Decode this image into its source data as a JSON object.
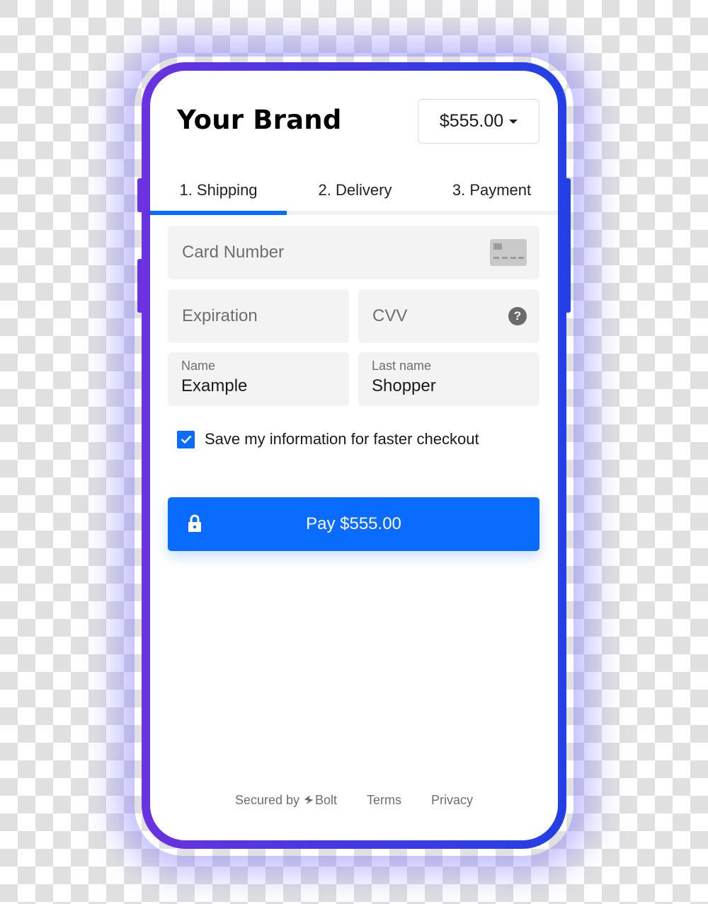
{
  "header": {
    "brand": "Your Brand",
    "amount_selector": "$555.00"
  },
  "tabs": [
    {
      "label": "1. Shipping",
      "active": true
    },
    {
      "label": "2. Delivery",
      "active": false
    },
    {
      "label": "3. Payment",
      "active": false
    }
  ],
  "form": {
    "card_number": {
      "placeholder": "Card Number",
      "icon": "credit-card-icon"
    },
    "expiration": {
      "placeholder": "Expiration"
    },
    "cvv": {
      "placeholder": "CVV",
      "icon": "help-icon",
      "icon_glyph": "?"
    },
    "first_name": {
      "label": "Name",
      "value": "Example"
    },
    "last_name": {
      "label": "Last name",
      "value": "Shopper"
    },
    "save_info": {
      "label": "Save my information for faster checkout",
      "checked": true
    }
  },
  "pay_button": {
    "label": "Pay $555.00",
    "icon": "lock-icon"
  },
  "footer": {
    "secured_by": "Secured by",
    "provider": "Bolt",
    "terms": "Terms",
    "privacy": "Privacy"
  },
  "colors": {
    "accent": "#0a6cff",
    "frame_left": "#6a32e0",
    "frame_right": "#2240e6",
    "field_bg": "#f3f3f3"
  }
}
